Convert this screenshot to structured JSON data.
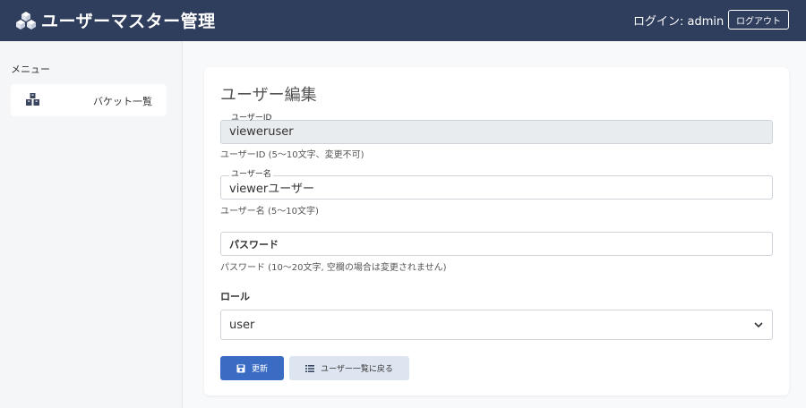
{
  "header": {
    "app_title": "ユーザーマスター管理",
    "logo_icon": "cubes-icon",
    "login_text": "ログイン: admin",
    "logout_label": "ログアウト",
    "bg_color": "#2f3e5c"
  },
  "sidebar": {
    "heading": "メニュー",
    "items": [
      {
        "label": "バケット一覧",
        "icon": "boxes-icon"
      }
    ]
  },
  "form": {
    "title": "ユーザー編集",
    "user_id": {
      "label": "ユーザーID",
      "value": "vieweruser",
      "help": "ユーザーID (5～10文字、変更不可)",
      "disabled": true
    },
    "user_name": {
      "label": "ユーザー名",
      "value": "viewerユーザー",
      "help": "ユーザー名 (5～10文字)"
    },
    "password": {
      "placeholder": "パスワード",
      "help": "パスワード (10～20文字, 空欄の場合は変更されません)"
    },
    "role": {
      "label": "ロール",
      "selected": "user"
    },
    "buttons": {
      "update_label": "更新",
      "update_icon": "save-icon",
      "back_label": "ユーザー一覧に戻る",
      "back_icon": "list-icon"
    }
  },
  "colors": {
    "primary": "#3b6cc4",
    "secondary": "#dde6f0"
  }
}
